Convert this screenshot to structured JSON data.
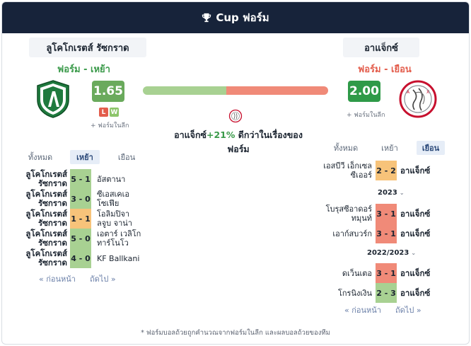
{
  "header": {
    "title": "Cup ฟอร์ม",
    "icon": "trophy-icon"
  },
  "home": {
    "name": "ลูโคโกเรตส์ รัซกราด",
    "form_label": "ฟอร์ม - เหย้า",
    "score": "1.65",
    "recent": [
      "L",
      "W"
    ],
    "league_note": "+ ฟอร์มในลีก",
    "tabs": [
      "ทั้งหมด",
      "เหย้า",
      "เยือน"
    ],
    "active_tab": "เหย้า",
    "matches": [
      {
        "team": "ลูโคโกเรตส์ รัซกราด",
        "score": "5 - 1",
        "opponent": "อัสตานา",
        "result": "win"
      },
      {
        "team": "ลูโคโกเรตส์ รัซกราด",
        "score": "3 - 0",
        "opponent": "ซีเอสเคเอ โซเฟีย",
        "result": "win"
      },
      {
        "team": "ลูโคโกเรตส์ รัซกราด",
        "score": "1 - 1",
        "opponent": "โอลิมปิจา ลจูบ จาน่า",
        "result": "draw"
      },
      {
        "team": "ลูโคโกเรตส์ รัซกราด",
        "score": "5 - 0",
        "opponent": "เอตาร์ เวลิโก ทาร์โนโว",
        "result": "win"
      },
      {
        "team": "ลูโคโกเรตส์ รัซกราด",
        "score": "4 - 0",
        "opponent": "KF Ballkani",
        "result": "win"
      }
    ],
    "prev": "« ก่อนหน้า",
    "next": "ถัดไป »"
  },
  "away": {
    "name": "อาแจ็กซ์",
    "form_label": "ฟอร์ม - เยือน",
    "score": "2.00",
    "league_note": "+ ฟอร์มในลีก",
    "tabs": [
      "ทั้งหมด",
      "เหย้า",
      "เยือน"
    ],
    "active_tab": "เยือน",
    "groups": [
      {
        "season": "",
        "matches": [
          {
            "opponent": "เอสบีวี เอ็กเซล ซีเออร์",
            "score": "2 - 2",
            "team": "อาแจ็กซ์",
            "result": "draw"
          }
        ]
      },
      {
        "season": "2023",
        "matches": [
          {
            "opponent": "โบรุสซีอาดอร์ ทมุนท์",
            "score": "3 - 1",
            "team": "อาแจ็กซ์",
            "result": "loss"
          },
          {
            "opponent": "เอาก์สบวร์ก",
            "score": "3 - 1",
            "team": "อาแจ็กซ์",
            "result": "loss"
          }
        ]
      },
      {
        "season": "2022/2023",
        "matches": [
          {
            "opponent": "ดเว็นเตอ",
            "score": "3 - 1",
            "team": "อาแจ็กซ์",
            "result": "loss"
          },
          {
            "opponent": "โกรนิงเงิน",
            "score": "2 - 3",
            "team": "อาแจ็กซ์",
            "result": "win"
          }
        ]
      }
    ],
    "prev": "« ก่อนหน้า",
    "next": "ถัดไป »"
  },
  "comparison": {
    "home_share": 0.45,
    "team": "อาแจ็กซ์",
    "pct": "+21%",
    "text": "ดีกว่าในเรื่องของ ฟอร์ม"
  },
  "colors": {
    "header": "#17233a",
    "win": "#a8d192",
    "draw": "#f7c37a",
    "loss": "#f08a78",
    "home_score": "#6aaa5c",
    "away_score": "#2f9a48"
  },
  "footnote": "* ฟอร์มบอลถ้วยถูกคำนวณจากฟอร์มในลีก และผลบอลถ้วยของทีม"
}
